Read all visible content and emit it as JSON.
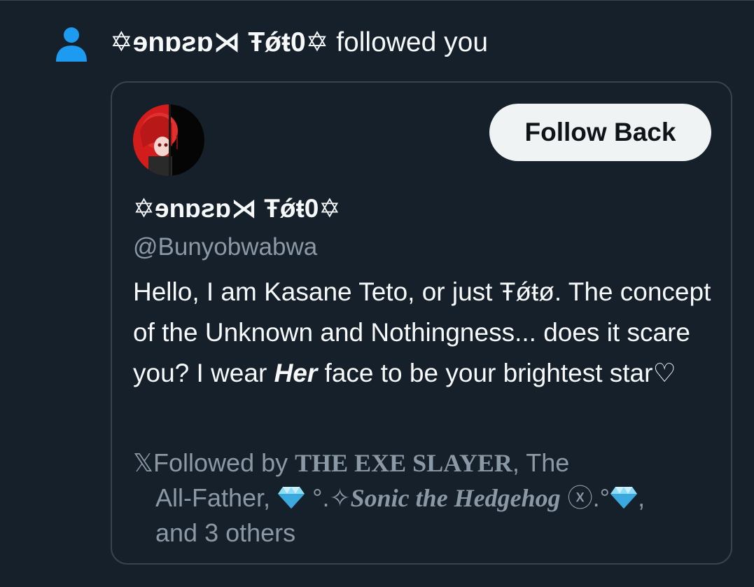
{
  "notification": {
    "name": "✡ɘnɒƨɒ⋊ Ŧǿŧ0✡",
    "text": " followed you",
    "icon": "person-icon",
    "icon_color": "#1d9bf0"
  },
  "profile": {
    "follow_button_label": "Follow Back",
    "display_name": "✡ɘnɒƨɒ⋊ Ŧǿŧ0✡",
    "handle": "@Bunyobwabwa",
    "bio_part1": "Hello, I am Kasane Teto, or just Ŧǿŧø. The concept of the Unknown and Nothingness... does it scare you? I wear ",
    "bio_emphasis": "Her",
    "bio_part2": " face to be your brightest star♡"
  },
  "followed_by": {
    "icon": "x-logo-icon",
    "prefix": "Followed by ",
    "name1": "THE EXE SLAYER",
    "sep1": ", The",
    "name2_cont": "All-Father, ",
    "name3_pre": " °.✧",
    "name3": "Sonic the Hedgehog",
    "name3_post": " ⓧ.°",
    "sep2": ",",
    "others": "and 3 others"
  },
  "colors": {
    "background": "#15202b",
    "border": "#38444d",
    "muted_text": "#8b98a5",
    "accent": "#1d9bf0",
    "button_bg": "#eff3f4"
  }
}
